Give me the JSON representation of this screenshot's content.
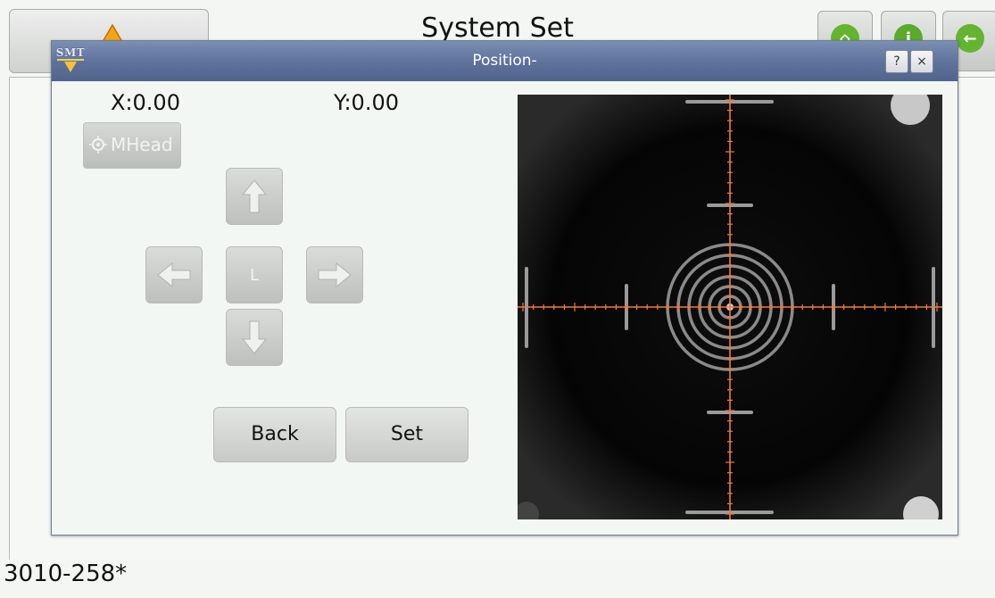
{
  "app": {
    "title": "System Set",
    "footer_code": "3010-258*",
    "top_icons": [
      "home-icon",
      "info-icon",
      "back-arrow-icon"
    ],
    "warning_icon": "warning-icon"
  },
  "dialog": {
    "logo_text": "SMT",
    "title": "Position-",
    "help_label": "?",
    "close_label": "×",
    "x_label": "X:0.00",
    "y_label": "Y:0.00",
    "mhead_label": "MHead",
    "jog_center_label": "L",
    "back_label": "Back",
    "set_label": "Set"
  },
  "colors": {
    "titlebar": "#5d719b",
    "crosshair": "#f07a3c",
    "button_gray": "#c8cac8"
  }
}
